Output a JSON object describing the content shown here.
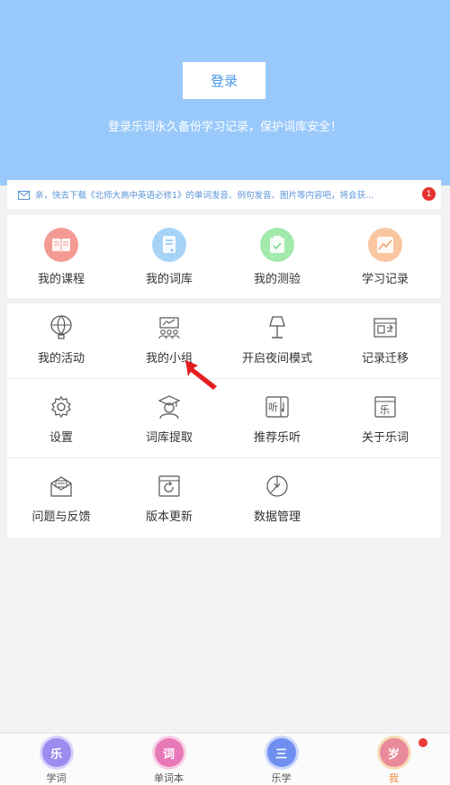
{
  "header": {
    "login_label": "登录",
    "tip": "登录乐词永久备份学习记录，保护词库安全！"
  },
  "notice": {
    "icon": "mail-icon",
    "text": "亲，快去下载《北师大高中英语必修1》的单词发音、例句发音、图片等内容吧，将会获...",
    "badge": "1"
  },
  "primary_grid": [
    {
      "label": "我的课程",
      "icon": "book-icon",
      "color": "#f28b82"
    },
    {
      "label": "我的词库",
      "icon": "wordbook-icon",
      "color": "#8ec5f5"
    },
    {
      "label": "我的测验",
      "icon": "quiz-icon",
      "color": "#8fe39a"
    },
    {
      "label": "学习记录",
      "icon": "chart-icon",
      "color": "#f7b98a"
    }
  ],
  "menu_rows": [
    [
      {
        "label": "我的活动",
        "icon": "balloon-icon"
      },
      {
        "label": "我的小组",
        "icon": "group-icon"
      },
      {
        "label": "开启夜间模式",
        "icon": "lamp-icon"
      },
      {
        "label": "记录迁移",
        "icon": "migrate-icon"
      }
    ],
    [
      {
        "label": "设置",
        "icon": "gear-icon"
      },
      {
        "label": "词库提取",
        "icon": "graduate-icon"
      },
      {
        "label": "推荐乐听",
        "icon": "listen-icon"
      },
      {
        "label": "关于乐词",
        "icon": "about-icon"
      }
    ],
    [
      {
        "label": "问题与反馈",
        "icon": "feedback-icon"
      },
      {
        "label": "版本更新",
        "icon": "update-icon"
      },
      {
        "label": "数据管理",
        "icon": "data-icon"
      }
    ]
  ],
  "tabbar": [
    {
      "label": "学词",
      "glyph": "乐",
      "color": "#9b8cf0"
    },
    {
      "label": "单词本",
      "glyph": "词",
      "color": "#e879b9"
    },
    {
      "label": "乐学",
      "glyph": "三",
      "color": "#6f8ff0"
    },
    {
      "label": "我",
      "glyph": "岁",
      "color": "#e98a9a",
      "active": true
    }
  ],
  "colors": {
    "header_bg": "#99c9fb",
    "accent": "#4a97e8",
    "active_tab": "#f0873a",
    "badge": "#e63030"
  }
}
